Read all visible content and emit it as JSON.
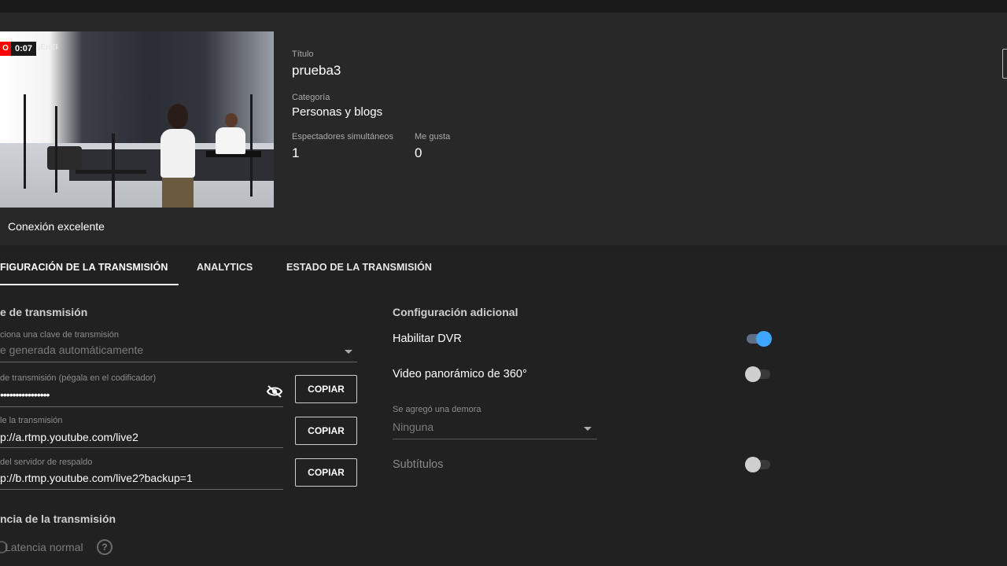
{
  "stream": {
    "live_badge": "O",
    "elapsed": "0:07",
    "watermark": "¡EnEl",
    "connection_status": "Conexión excelente"
  },
  "details": {
    "title_label": "Título",
    "title_value": "prueba3",
    "category_label": "Categoría",
    "category_value": "Personas y blogs",
    "viewers_label": "Espectadores simultáneos",
    "viewers_value": "1",
    "likes_label": "Me gusta",
    "likes_value": "0"
  },
  "tabs": [
    {
      "label": "FIGURACIÓN DE LA TRANSMISIÓN",
      "active": true
    },
    {
      "label": "ANALYTICS",
      "active": false
    },
    {
      "label": "ESTADO DE LA TRANSMISIÓN",
      "active": false
    }
  ],
  "stream_key": {
    "section_title": "e de transmisión",
    "select_label": "ciona una clave de transmisión",
    "select_value": "e generada automáticamente",
    "key_label": "de transmisión (pégala en el codificador)",
    "key_value": "••••••••••••••••",
    "url_label": "le la transmisión",
    "url_value": "p://a.rtmp.youtube.com/live2",
    "backup_label": "del servidor de respaldo",
    "backup_value": "p://b.rtmp.youtube.com/live2?backup=1",
    "copy_label": "COPIAR"
  },
  "latency": {
    "section_title": "ncia de la transmisión",
    "option": "Latencia normal",
    "help_icon_text": "?"
  },
  "additional": {
    "section_title": "Configuración adicional",
    "dvr_label": "Habilitar DVR",
    "dvr_enabled": true,
    "panoramic_label": "Video panorámico de 360°",
    "panoramic_enabled": false,
    "delay_label": "Se agregó una demora",
    "delay_value": "Ninguna",
    "subtitles_label": "Subtítulos",
    "subtitles_enabled": false
  },
  "colors": {
    "background": "#212121",
    "panel": "#282828",
    "accent_blue": "#3ea6ff",
    "live_red": "#ff0000"
  },
  "icons": [
    "eye-off-icon",
    "dropdown-caret-icon",
    "help-circle-icon",
    "radio-icon"
  ]
}
